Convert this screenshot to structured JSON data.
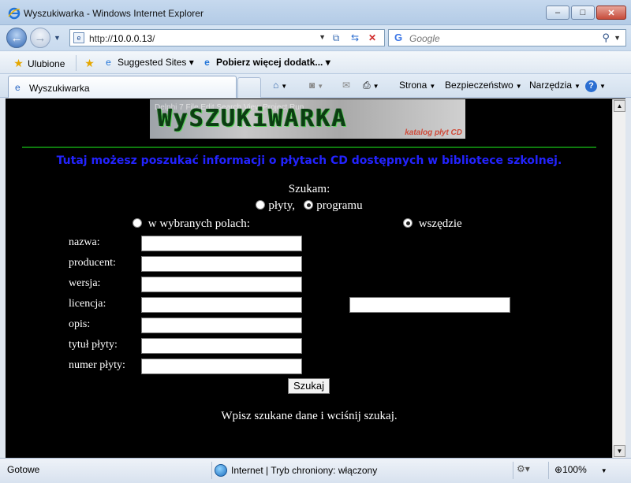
{
  "window": {
    "title": "Wyszukiwarka - Windows Internet Explorer",
    "minimize": "–",
    "maximize": "□",
    "close": "✕"
  },
  "address": {
    "url_prefix": "http://",
    "url_host": "10.0.0.13",
    "url_suffix": "/",
    "search_placeholder": "Google"
  },
  "favorites": {
    "favorites_label": "Ulubione",
    "suggested_sites": "Suggested Sites ▾",
    "get_more_addons": "Pobierz więcej dodatk... ▾"
  },
  "tabs": {
    "active_tab": "Wyszukiwarka"
  },
  "command_bar": {
    "page": "Strona",
    "safety": "Bezpieczeństwo",
    "tools": "Narzędzia"
  },
  "page": {
    "logo_text": "WySZUKiWARKA",
    "logo_ghost_top": "Delphi 7   File   Edit   Search   View   Project   Run",
    "logo_subtitle": "katalog płyt CD",
    "intro": "Tutaj możesz poszukać informacji o płytach CD dostępnych w bibliotece szkolnej.",
    "search_for_label": "Szukam:",
    "type_options": [
      {
        "label": "płyty,",
        "selected": false
      },
      {
        "label": "programu",
        "selected": true
      }
    ],
    "scope_options": [
      {
        "label": "w wybranych polach:",
        "selected": false
      },
      {
        "label": "wszędzie",
        "selected": true
      }
    ],
    "fields": [
      {
        "label": "nazwa:",
        "value": ""
      },
      {
        "label": "producent:",
        "value": ""
      },
      {
        "label": "wersja:",
        "value": ""
      },
      {
        "label": "licencja:",
        "value": ""
      },
      {
        "label": "opis:",
        "value": ""
      },
      {
        "label": "tytuł płyty:",
        "value": ""
      },
      {
        "label": "numer płyty:",
        "value": ""
      }
    ],
    "everywhere_value": "",
    "search_button": "Szukaj",
    "hint": "Wpisz szukane dane i wciśnij szukaj."
  },
  "status": {
    "left": "Gotowe",
    "zone": "Internet | Tryb chroniony: włączony",
    "zoom": "100%"
  },
  "colors": {
    "page_background": "#000000",
    "intro_text": "#2323ff",
    "divider": "#0f7a0f",
    "body_text": "#ffffff"
  }
}
